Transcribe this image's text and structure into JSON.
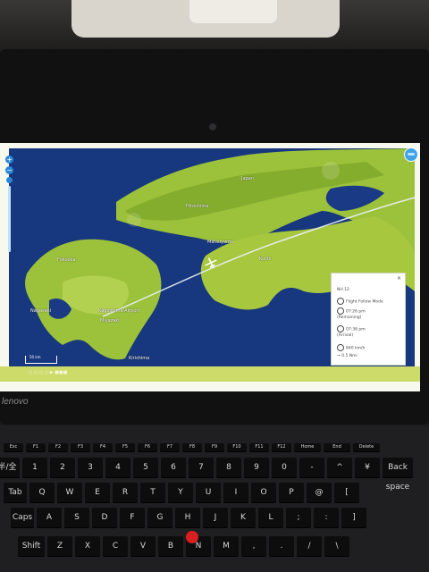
{
  "map": {
    "labels": {
      "sea_north": "Japan",
      "island_upper": "Hiroshima",
      "city_center": "Matsuyama",
      "city_right": "Kochi",
      "city_left": "Fukuoka",
      "island_lower": "Nagasaki",
      "airport": "Kagoshima Airport",
      "city_south": "Miyazaki",
      "small_south": "Kirishima"
    },
    "scale": "50 km",
    "info_panel": {
      "close": "×",
      "title": "NH 12",
      "rows": [
        "Flight Follow Mode",
        "07:26 pm",
        "(Remaining)",
        "07:36 pm",
        "(Arrival)",
        "840 km/h",
        "→ 0.5 Nmi"
      ]
    },
    "bottom_text": "○ ○ ○ ○ ▶ ■■■"
  },
  "brand": "lenovo",
  "keyboard": {
    "fn_row": [
      "Esc",
      "F1",
      "F2",
      "F3",
      "F4",
      "F5",
      "F6",
      "F7",
      "F8",
      "F9",
      "F10",
      "F11",
      "F12",
      "Home",
      "End",
      "Delete"
    ],
    "row1": [
      "半/全",
      "1",
      "2",
      "3",
      "4",
      "5",
      "6",
      "7",
      "8",
      "9",
      "0",
      "-",
      "^",
      "¥",
      "Back space"
    ],
    "row2": [
      "Tab",
      "Q",
      "W",
      "E",
      "R",
      "T",
      "Y",
      "U",
      "I",
      "O",
      "P",
      "@",
      "["
    ],
    "row3": [
      "Caps",
      "A",
      "S",
      "D",
      "F",
      "G",
      "H",
      "J",
      "K",
      "L",
      ";",
      ":",
      "]"
    ],
    "row4": [
      "Shift",
      "Z",
      "X",
      "C",
      "V",
      "B",
      "N",
      "M",
      ",",
      ".",
      "/",
      "\\"
    ]
  }
}
